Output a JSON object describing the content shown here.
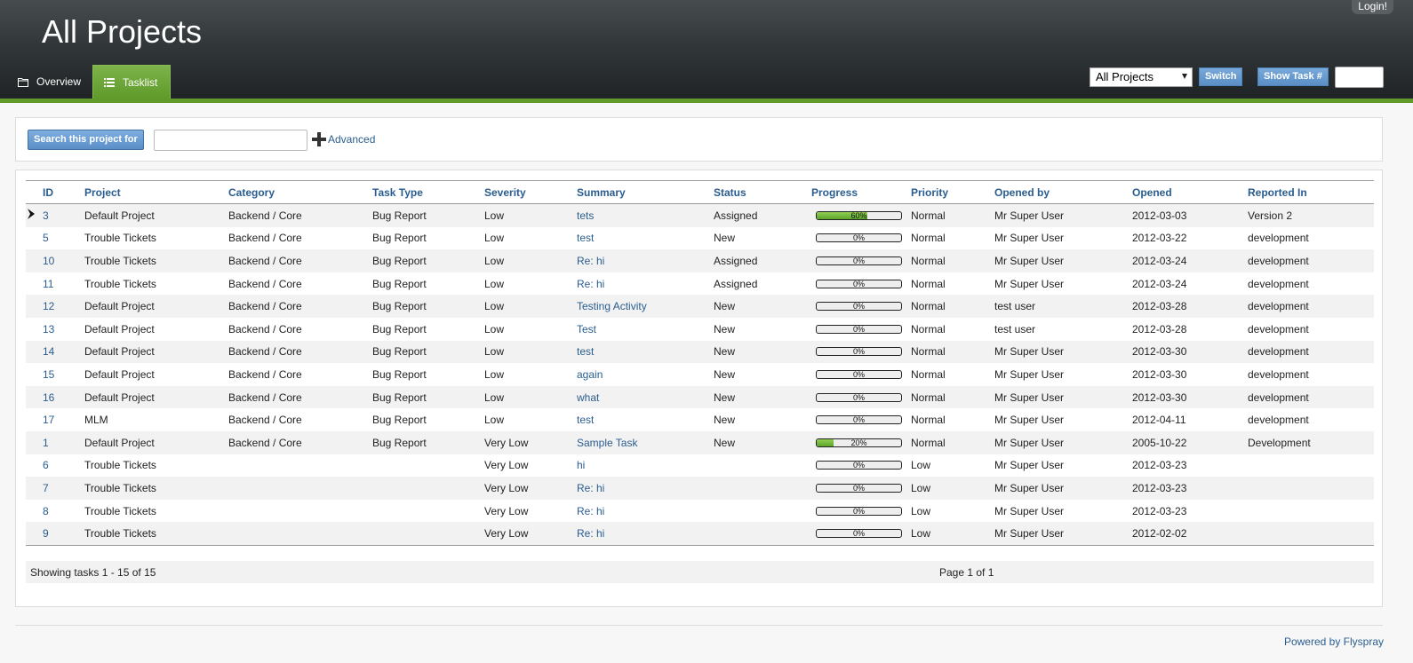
{
  "header": {
    "title": "All Projects",
    "login_label": "Login!",
    "tabs": [
      {
        "label": "Overview",
        "icon": "folder-icon"
      },
      {
        "label": "Tasklist",
        "icon": "list-icon"
      }
    ],
    "project_select": {
      "selected": "All Projects"
    },
    "switch_label": "Switch",
    "show_task_label": "Show Task #",
    "task_number_value": ""
  },
  "search": {
    "button_label": "Search this project for",
    "input_value": "",
    "advanced_label": "Advanced"
  },
  "table": {
    "columns": [
      "ID",
      "Project",
      "Category",
      "Task Type",
      "Severity",
      "Summary",
      "Status",
      "Progress",
      "Priority",
      "Opened by",
      "Opened",
      "Reported In"
    ],
    "rows": [
      {
        "id": "3",
        "project": "Default Project",
        "category": "Backend / Core",
        "task_type": "Bug Report",
        "severity": "Low",
        "summary": "tets",
        "status": "Assigned",
        "progress": 60,
        "progress_label": "60%",
        "priority": "Normal",
        "opened_by": "Mr Super User",
        "opened": "2012-03-03",
        "reported_in": "Version 2"
      },
      {
        "id": "5",
        "project": "Trouble Tickets",
        "category": "Backend / Core",
        "task_type": "Bug Report",
        "severity": "Low",
        "summary": "test",
        "status": "New",
        "progress": 0,
        "progress_label": "0%",
        "priority": "Normal",
        "opened_by": "Mr Super User",
        "opened": "2012-03-22",
        "reported_in": "development"
      },
      {
        "id": "10",
        "project": "Trouble Tickets",
        "category": "Backend / Core",
        "task_type": "Bug Report",
        "severity": "Low",
        "summary": "Re: hi",
        "status": "Assigned",
        "progress": 0,
        "progress_label": "0%",
        "priority": "Normal",
        "opened_by": "Mr Super User",
        "opened": "2012-03-24",
        "reported_in": "development"
      },
      {
        "id": "11",
        "project": "Trouble Tickets",
        "category": "Backend / Core",
        "task_type": "Bug Report",
        "severity": "Low",
        "summary": "Re: hi",
        "status": "Assigned",
        "progress": 0,
        "progress_label": "0%",
        "priority": "Normal",
        "opened_by": "Mr Super User",
        "opened": "2012-03-24",
        "reported_in": "development"
      },
      {
        "id": "12",
        "project": "Default Project",
        "category": "Backend / Core",
        "task_type": "Bug Report",
        "severity": "Low",
        "summary": "Testing Activity",
        "status": "New",
        "progress": 0,
        "progress_label": "0%",
        "priority": "Normal",
        "opened_by": "test user",
        "opened": "2012-03-28",
        "reported_in": "development"
      },
      {
        "id": "13",
        "project": "Default Project",
        "category": "Backend / Core",
        "task_type": "Bug Report",
        "severity": "Low",
        "summary": "Test",
        "status": "New",
        "progress": 0,
        "progress_label": "0%",
        "priority": "Normal",
        "opened_by": "test user",
        "opened": "2012-03-28",
        "reported_in": "development"
      },
      {
        "id": "14",
        "project": "Default Project",
        "category": "Backend / Core",
        "task_type": "Bug Report",
        "severity": "Low",
        "summary": "test",
        "status": "New",
        "progress": 0,
        "progress_label": "0%",
        "priority": "Normal",
        "opened_by": "Mr Super User",
        "opened": "2012-03-30",
        "reported_in": "development"
      },
      {
        "id": "15",
        "project": "Default Project",
        "category": "Backend / Core",
        "task_type": "Bug Report",
        "severity": "Low",
        "summary": "again",
        "status": "New",
        "progress": 0,
        "progress_label": "0%",
        "priority": "Normal",
        "opened_by": "Mr Super User",
        "opened": "2012-03-30",
        "reported_in": "development"
      },
      {
        "id": "16",
        "project": "Default Project",
        "category": "Backend / Core",
        "task_type": "Bug Report",
        "severity": "Low",
        "summary": "what",
        "status": "New",
        "progress": 0,
        "progress_label": "0%",
        "priority": "Normal",
        "opened_by": "Mr Super User",
        "opened": "2012-03-30",
        "reported_in": "development"
      },
      {
        "id": "17",
        "project": "MLM",
        "category": "Backend / Core",
        "task_type": "Bug Report",
        "severity": "Low",
        "summary": "test",
        "status": "New",
        "progress": 0,
        "progress_label": "0%",
        "priority": "Normal",
        "opened_by": "Mr Super User",
        "opened": "2012-04-11",
        "reported_in": "development"
      },
      {
        "id": "1",
        "project": "Default Project",
        "category": "Backend / Core",
        "task_type": "Bug Report",
        "severity": "Very Low",
        "summary": "Sample Task",
        "status": "New",
        "progress": 20,
        "progress_label": "20%",
        "priority": "Normal",
        "opened_by": "Mr Super User",
        "opened": "2005-10-22",
        "reported_in": "Development"
      },
      {
        "id": "6",
        "project": "Trouble Tickets",
        "category": "",
        "task_type": "",
        "severity": "Very Low",
        "summary": "hi",
        "status": "",
        "progress": 0,
        "progress_label": "0%",
        "priority": "Low",
        "opened_by": "Mr Super User",
        "opened": "2012-03-23",
        "reported_in": ""
      },
      {
        "id": "7",
        "project": "Trouble Tickets",
        "category": "",
        "task_type": "",
        "severity": "Very Low",
        "summary": "Re: hi",
        "status": "",
        "progress": 0,
        "progress_label": "0%",
        "priority": "Low",
        "opened_by": "Mr Super User",
        "opened": "2012-03-23",
        "reported_in": ""
      },
      {
        "id": "8",
        "project": "Trouble Tickets",
        "category": "",
        "task_type": "",
        "severity": "Very Low",
        "summary": "Re: hi",
        "status": "",
        "progress": 0,
        "progress_label": "0%",
        "priority": "Low",
        "opened_by": "Mr Super User",
        "opened": "2012-03-23",
        "reported_in": ""
      },
      {
        "id": "9",
        "project": "Trouble Tickets",
        "category": "",
        "task_type": "",
        "severity": "Very Low",
        "summary": "Re: hi",
        "status": "",
        "progress": 0,
        "progress_label": "0%",
        "priority": "Low",
        "opened_by": "Mr Super User",
        "opened": "2012-02-02",
        "reported_in": ""
      }
    ]
  },
  "pager": {
    "showing": "Showing tasks 1 - 15 of 15",
    "page": "Page 1 of 1"
  },
  "footer": {
    "powered_by": "Powered by Flyspray"
  },
  "colors": {
    "accent_green": "#5f9a2a",
    "link_blue": "#2a5d8f",
    "button_blue": "#5a8fc6"
  }
}
